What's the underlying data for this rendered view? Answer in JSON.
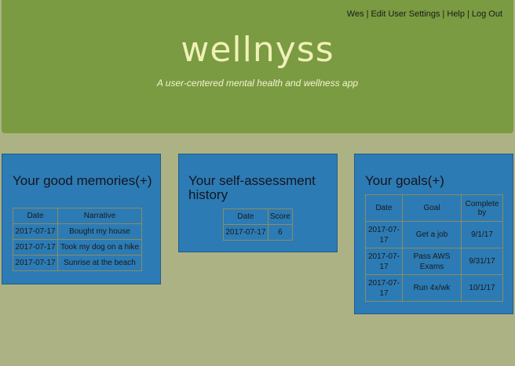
{
  "user_nav": {
    "username": "Wes",
    "edit_settings": "Edit User Settings",
    "help": "Help",
    "logout": "Log Out",
    "separator": "|"
  },
  "header": {
    "brand": "wellnyss",
    "tagline": "A user-centered mental health and wellness app"
  },
  "memories": {
    "title": "Your good memories",
    "add_label": "(+)",
    "columns": [
      "Date",
      "Narrative"
    ],
    "rows": [
      {
        "date": "2017-07-17",
        "narrative": "Bought my house"
      },
      {
        "date": "2017-07-17",
        "narrative": "Took my dog on a hike"
      },
      {
        "date": "2017-07-17",
        "narrative": "Sunrise at the beach"
      }
    ]
  },
  "assessment": {
    "title": "Your self-assessment history",
    "columns": [
      "Date",
      "Score"
    ],
    "rows": [
      {
        "date": "2017-07-17",
        "score": "6"
      }
    ]
  },
  "goals": {
    "title": "Your goals",
    "add_label": "(+)",
    "columns": [
      "Date",
      "Goal",
      "Complete by"
    ],
    "rows": [
      {
        "date": "2017-07-17",
        "goal": "Get a job",
        "complete_by": "9/1/17"
      },
      {
        "date": "2017-07-17",
        "goal": "Pass AWS Exams",
        "complete_by": "9/31/17"
      },
      {
        "date": "2017-07-17",
        "goal": "Run 4x/wk",
        "complete_by": "10/1/17"
      }
    ]
  },
  "colors": {
    "header_bg": "#7a9b41",
    "page_bg": "#adb285",
    "card_bg": "#2c7bb4",
    "brand_text": "#f1f0b8"
  }
}
